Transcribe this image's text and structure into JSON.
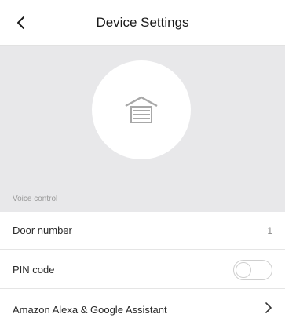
{
  "header": {
    "title": "Device Settings",
    "back_icon": "chevron-left-icon"
  },
  "hero": {
    "device_icon": "garage-door-icon",
    "section_label": "Voice control"
  },
  "rows": {
    "door_number": {
      "label": "Door number",
      "value": "1"
    },
    "pin_code": {
      "label": "PIN code",
      "toggle_on": false
    },
    "voice_assistant": {
      "label": "Amazon Alexa & Google Assistant",
      "icon": "chevron-right-icon"
    }
  },
  "colors": {
    "hero_background": "#e8e8ea",
    "divider": "#e5e5e5",
    "secondary_text": "#9a9a9a"
  }
}
